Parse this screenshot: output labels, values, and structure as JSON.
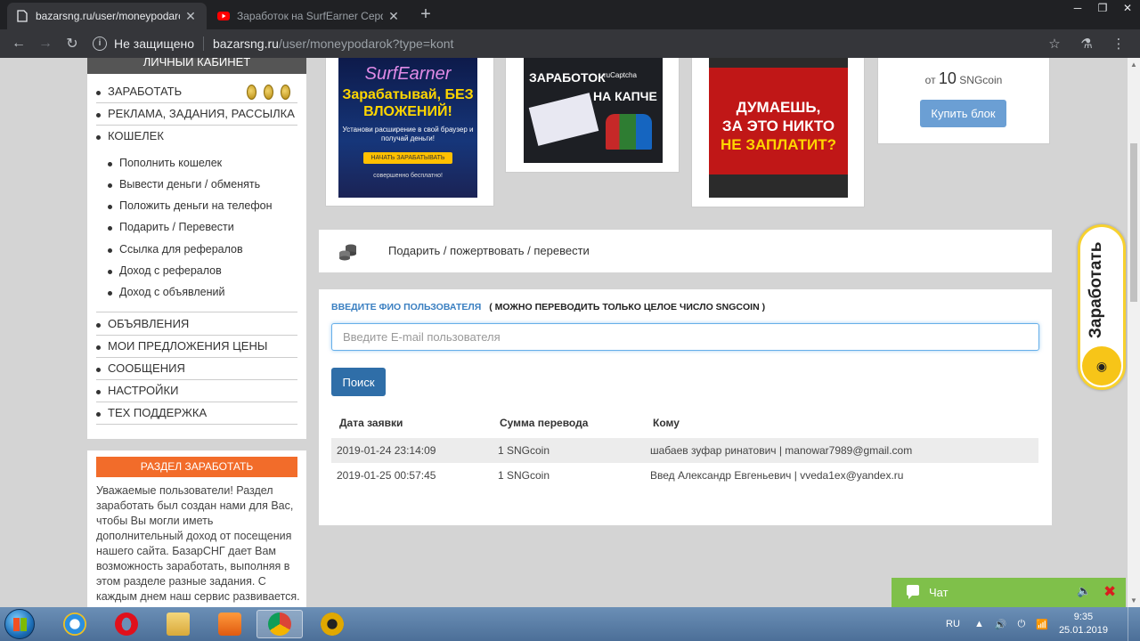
{
  "browser": {
    "tabs": [
      {
        "title": "bazarsng.ru/user/moneypodarok"
      },
      {
        "title": "Заработок на SurfEarner Серфё"
      }
    ],
    "address": {
      "security_label": "Не защищено",
      "host": "bazarsng.ru",
      "path": "/user/moneypodarok?type=kont"
    }
  },
  "sidebar": {
    "header": "Личный кабинет",
    "menu": [
      {
        "label": "Заработать"
      },
      {
        "label": "Реклама, задания, рассылка"
      },
      {
        "label": "Кошелек"
      }
    ],
    "wallet_items": [
      {
        "label": "Пополнить кошелек"
      },
      {
        "label": "Вывести деньги / обменять"
      },
      {
        "label": "Положить деньги на телефон"
      },
      {
        "label": "Подарить / Перевести"
      },
      {
        "label": "Ссылка для рефералов"
      },
      {
        "label": "Доход с рефералов"
      },
      {
        "label": "Доход с объявлений"
      }
    ],
    "menu2": [
      {
        "label": "Объявления"
      },
      {
        "label": "Мои предложения цены"
      },
      {
        "label": "Сообщения"
      },
      {
        "label": "Настройки"
      },
      {
        "label": "Тех поддержка"
      }
    ]
  },
  "earn_section": {
    "title": "Раздел заработать",
    "text": "Уважаемые пользователи! Раздел заработать был создан нами для Вас, чтобы Вы могли иметь дополнительный доход от посещения нашего сайта. БазарСНГ дает Вам возможность заработать, выполняя в этом разделе разные задания. С каждым днем наш сервис развивается. Мы ищем новых"
  },
  "banners": {
    "surfearner": {
      "brand": "SurfEarner",
      "headline": "Зарабатывай, БЕЗ ВЛОЖЕНИЙ!",
      "sub": "Установи расширение в свой браузер и получай деньги!",
      "button": "НАЧАТЬ ЗАРАБАТЫВАТЬ",
      "footer": "совершенно бесплатно!"
    },
    "rucaptcha": {
      "line1": "ЗАРАБОТОК",
      "brand": "ruCaptcha",
      "line2": "НА КАПЧЕ"
    },
    "promo": {
      "line1": "ДУМАЕШЬ,",
      "line2": "ЗА ЭТО НИКТО",
      "line3": "НЕ ЗАПЛАТИТ?"
    },
    "buy": {
      "price_prefix": "от",
      "price_amount": "10",
      "price_unit": "SNGcoin",
      "button": "Купить блок"
    }
  },
  "transfer": {
    "heading": "Подарить / пожертвовать / перевести",
    "label_main": "Введите ФИО пользователя",
    "label_note": "( можно переводить только целое число SNGcoin )",
    "input_placeholder": "Введите E-mail пользователя",
    "search_button": "Поиск",
    "columns": [
      "Дата заявки",
      "Сумма перевода",
      "Кому"
    ],
    "rows": [
      {
        "date": "2019-01-24 23:14:09",
        "amount": "1 SNGcoin",
        "to": "шабаев зуфар ринатович | manowar7989@gmail.com"
      },
      {
        "date": "2019-01-25 00:57:45",
        "amount": "1 SNGcoin",
        "to": "Введ Александр Евгеньевич | vveda1ex@yandex.ru"
      }
    ]
  },
  "widget": {
    "label": "Заработать"
  },
  "chat": {
    "label": "Чат"
  },
  "taskbar": {
    "lang": "RU",
    "time": "9:35",
    "date": "25.01.2019"
  },
  "colors": {
    "accent_orange": "#f26c2a",
    "button_blue": "#2f6ea8",
    "link_blue": "#3a7fc1",
    "chat_green": "#7fc04a"
  }
}
